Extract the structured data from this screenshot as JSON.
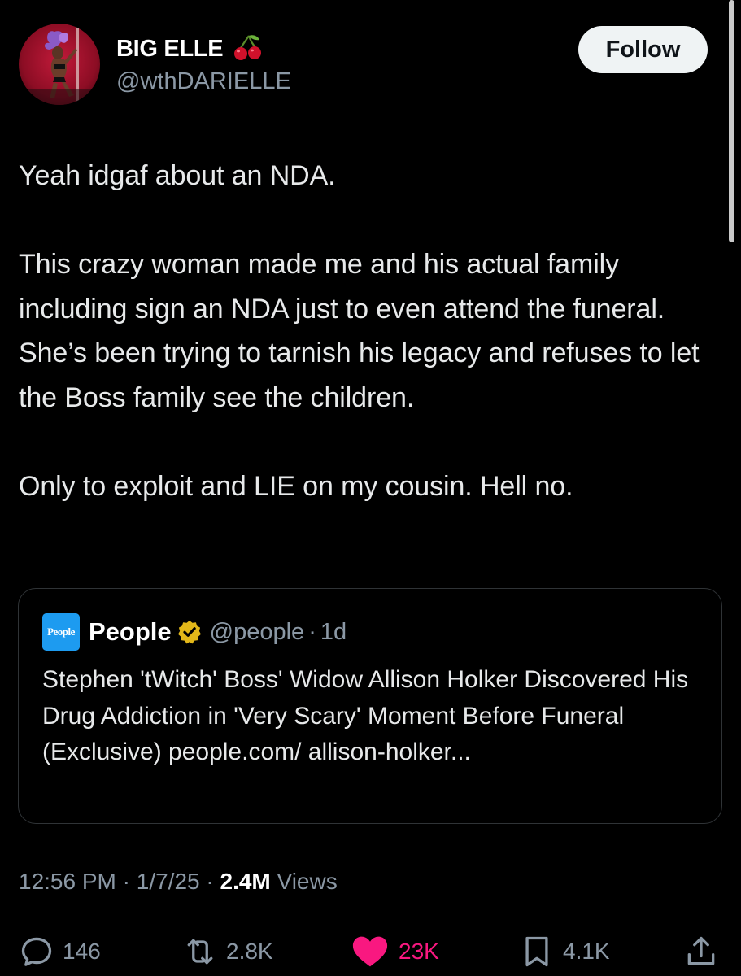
{
  "author": {
    "display_name": "BIG ELLE",
    "emoji": "cherries",
    "handle": "@wthDARIELLE",
    "follow_label": "Follow"
  },
  "tweet": {
    "text": "Yeah idgaf about an NDA.\n\nThis crazy woman made me and his actual family including sign an NDA just to even attend the funeral. She’s been trying to tarnish his legacy and refuses to let the Boss family see the children.\n\nOnly to exploit and LIE on my cousin. Hell no."
  },
  "quote": {
    "logo_text": "People",
    "name": "People",
    "verified": "gold-verified-badge",
    "handle": "@people",
    "separator": "·",
    "time": "1d",
    "text": "Stephen 'tWitch' Boss' Widow Allison Holker Discovered His Drug Addiction in 'Very Scary' Moment Before Funeral (Exclusive) people.com/ allison-holker..."
  },
  "meta": {
    "time": "12:56 PM",
    "date": "1/7/25",
    "separator": "·",
    "views_count": "2.4M",
    "views_label": "Views"
  },
  "actions": {
    "replies": "146",
    "reposts": "2.8K",
    "likes": "23K",
    "bookmarks": "4.1K"
  },
  "icons": {
    "reply": "reply-icon",
    "repost": "repost-icon",
    "like": "heart-icon",
    "bookmark": "bookmark-icon",
    "share": "share-icon"
  },
  "colors": {
    "background": "#000000",
    "text": "#e7e9ea",
    "secondary": "#8b98a5",
    "like": "#f91880",
    "people_brand": "#1d9bf0",
    "verified_gold": "#e2b719"
  }
}
